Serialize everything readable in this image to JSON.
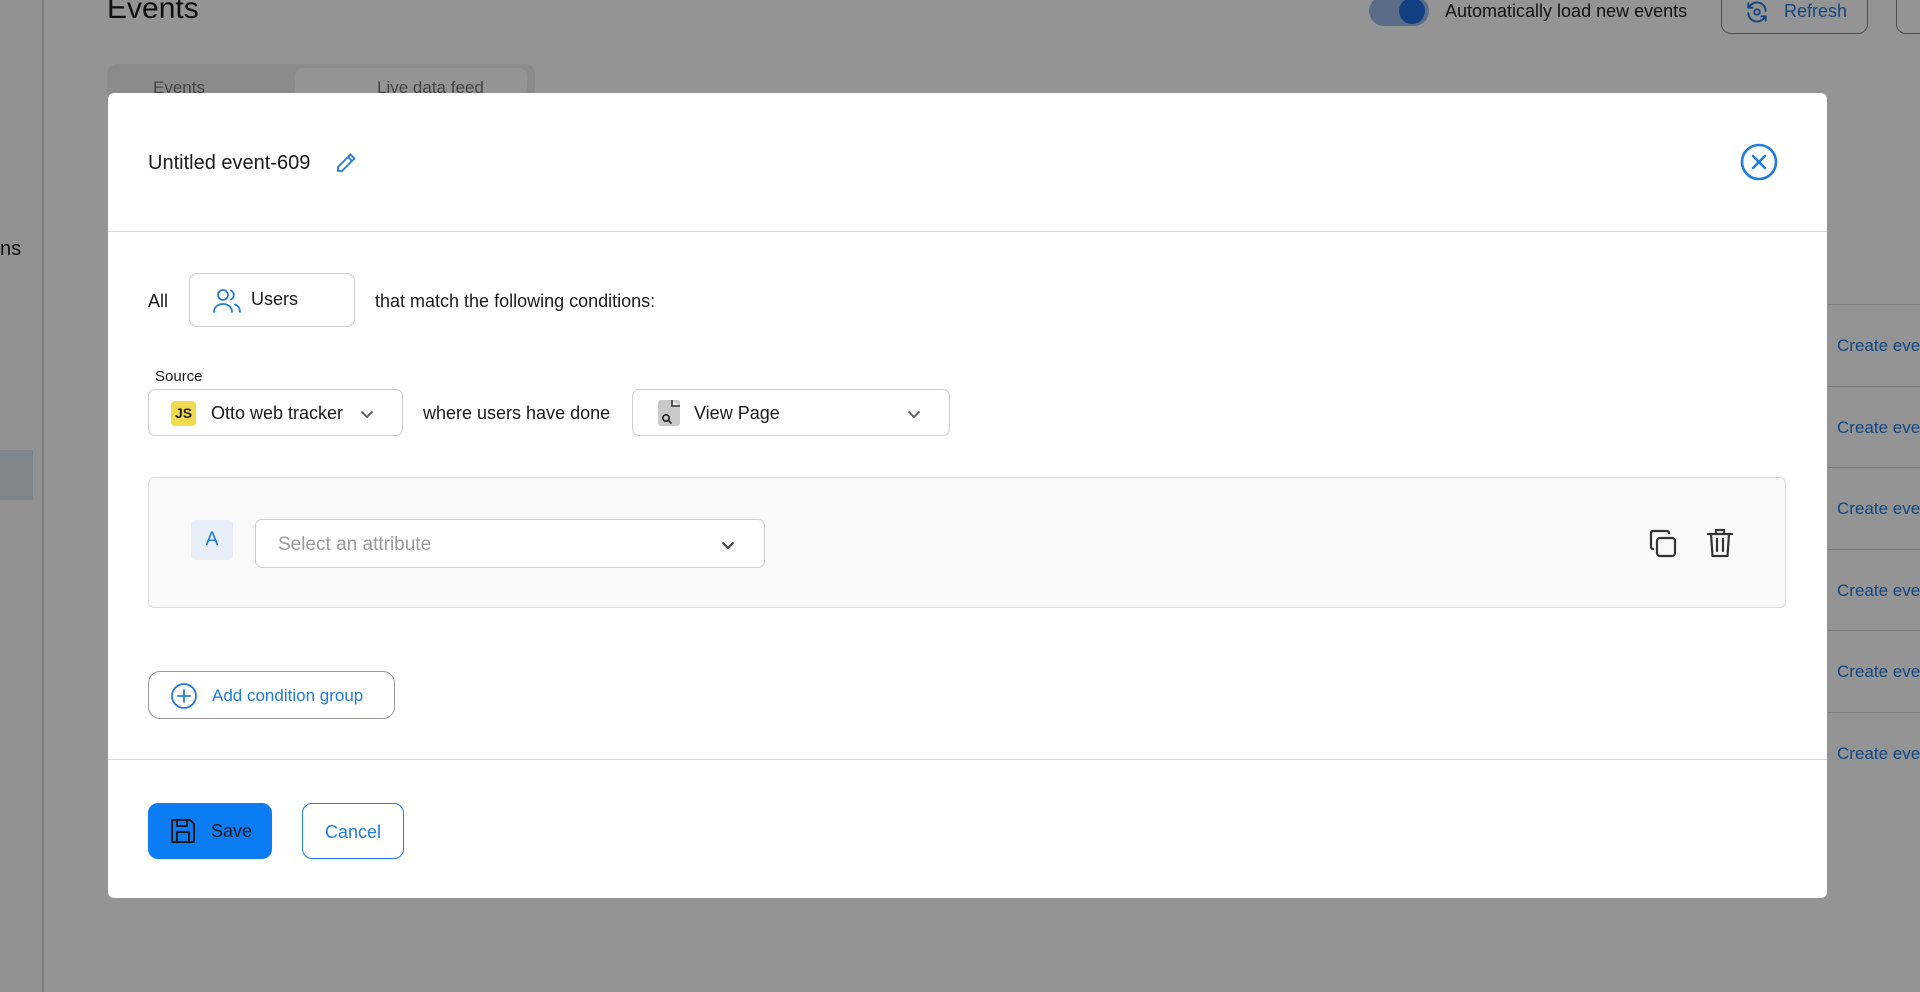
{
  "background": {
    "page_title": "Events",
    "sidebar_partial_text": "ns",
    "auto_load_label": "Automatically load new events",
    "refresh_label": "Refresh",
    "tabs": [
      {
        "label": "Events"
      },
      {
        "label": "Live data feed"
      }
    ],
    "row_links": [
      "Create eve",
      "Create eve",
      "Create eve",
      "Create eve",
      "Create eve",
      "Create eve"
    ]
  },
  "modal": {
    "title": "Untitled event-609",
    "all_label": "All",
    "entity_button_label": "Users",
    "match_text": "that match the following conditions:",
    "source": {
      "label": "Source",
      "badge": "JS",
      "value": "Otto web tracker"
    },
    "where_text": "where users have done",
    "event_select": {
      "value": "View Page"
    },
    "condition_group": {
      "letter": "A",
      "attribute_placeholder": "Select an attribute"
    },
    "add_condition_group_label": "Add condition group",
    "footer": {
      "save_label": "Save",
      "cancel_label": "Cancel"
    }
  },
  "colors": {
    "accent": "#1f7be0",
    "primary_button": "#0b7cf1",
    "js_badge": "#f0db4f",
    "overlay": "rgba(0,0,0,0.42)"
  }
}
